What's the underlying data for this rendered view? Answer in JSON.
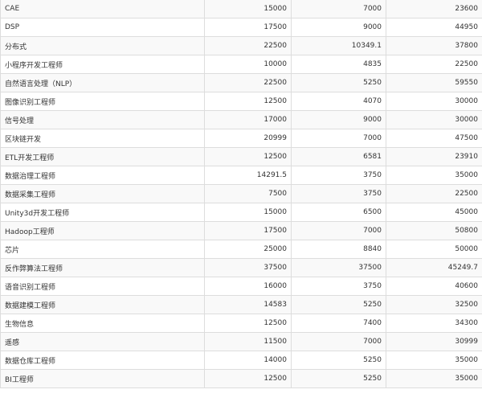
{
  "table": {
    "rows": [
      {
        "name": "CAE",
        "v1": "15000",
        "v2": "7000",
        "v3": "23600"
      },
      {
        "name": "DSP",
        "v1": "17500",
        "v2": "9000",
        "v3": "44950"
      },
      {
        "name": "分布式",
        "v1": "22500",
        "v2": "10349.1",
        "v3": "37800"
      },
      {
        "name": "小程序开发工程师",
        "v1": "10000",
        "v2": "4835",
        "v3": "22500"
      },
      {
        "name": "自然语言处理（NLP）",
        "v1": "22500",
        "v2": "5250",
        "v3": "59550"
      },
      {
        "name": "图像识别工程师",
        "v1": "12500",
        "v2": "4070",
        "v3": "30000"
      },
      {
        "name": "信号处理",
        "v1": "17000",
        "v2": "9000",
        "v3": "30000"
      },
      {
        "name": "区块链开发",
        "v1": "20999",
        "v2": "7000",
        "v3": "47500"
      },
      {
        "name": "ETL开发工程师",
        "v1": "12500",
        "v2": "6581",
        "v3": "23910"
      },
      {
        "name": "数据治理工程师",
        "v1": "14291.5",
        "v2": "3750",
        "v3": "35000"
      },
      {
        "name": "数据采集工程师",
        "v1": "7500",
        "v2": "3750",
        "v3": "22500"
      },
      {
        "name": "Unity3d开发工程师",
        "v1": "15000",
        "v2": "6500",
        "v3": "45000"
      },
      {
        "name": "Hadoop工程师",
        "v1": "17500",
        "v2": "7000",
        "v3": "50800"
      },
      {
        "name": "芯片",
        "v1": "25000",
        "v2": "8840",
        "v3": "50000"
      },
      {
        "name": "反作弊算法工程师",
        "v1": "37500",
        "v2": "37500",
        "v3": "45249.7"
      },
      {
        "name": "语音识别工程师",
        "v1": "16000",
        "v2": "3750",
        "v3": "40600"
      },
      {
        "name": "数据建模工程师",
        "v1": "14583",
        "v2": "5250",
        "v3": "32500"
      },
      {
        "name": "生物信息",
        "v1": "12500",
        "v2": "7400",
        "v3": "34300"
      },
      {
        "name": "遥感",
        "v1": "11500",
        "v2": "7000",
        "v3": "30999"
      },
      {
        "name": "数据仓库工程师",
        "v1": "14000",
        "v2": "5250",
        "v3": "35000"
      },
      {
        "name": "BI工程师",
        "v1": "12500",
        "v2": "5250",
        "v3": "35000"
      }
    ]
  }
}
